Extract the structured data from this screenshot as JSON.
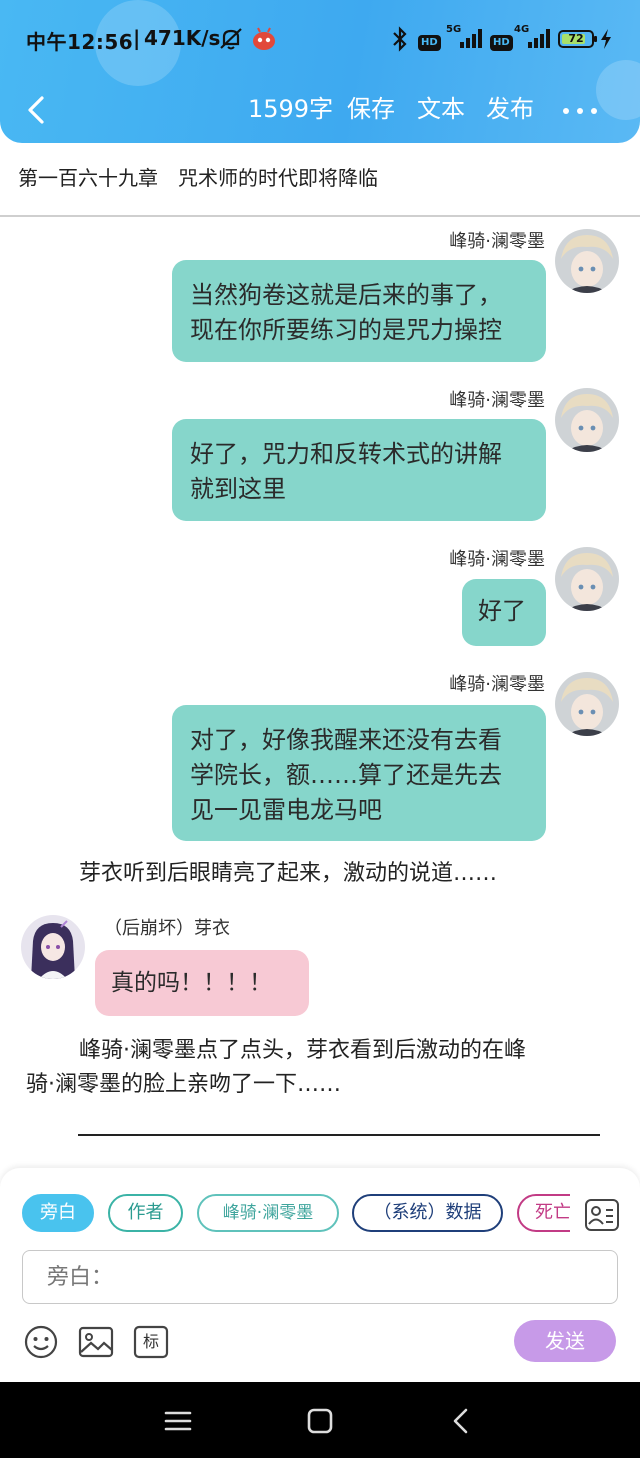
{
  "status_bar": {
    "time": "中午12:56",
    "speed": "471K/s",
    "signal_1": "5G",
    "signal_2": "4G",
    "battery": "72",
    "hd": "HD"
  },
  "header": {
    "word_count": "1599字",
    "save_label": "保存",
    "text_label": "文本",
    "publish_label": "发布"
  },
  "chapter": {
    "title": "第一百六十九章　咒术师的时代即将降临"
  },
  "messages": [
    {
      "name": "峰骑·澜零墨",
      "text_lines": [
        "当然狗卷这就是后来的事了，",
        "现在你所要练习的是咒力操控"
      ]
    },
    {
      "name": "峰骑·澜零墨",
      "text_lines": [
        "好了，咒力和反转术式的讲解",
        "就到这里"
      ]
    },
    {
      "name": "峰骑·澜零墨",
      "text_lines": [
        "好了"
      ]
    },
    {
      "name": "峰骑·澜零墨",
      "text_lines": [
        "对了，好像我醒来还没有去看",
        "学院长，额……算了还是先去",
        "见一见雷电龙马吧"
      ]
    }
  ],
  "narration_1": "芽衣听到后眼睛亮了起来，激动的说道……",
  "left_message": {
    "name": "（后崩坏）芽衣",
    "text": "真的吗！！！！"
  },
  "narration_2_lines": [
    "峰骑·澜零墨点了点头，芽衣看到后激动的在峰",
    "骑·澜零墨的脸上亲吻了一下……"
  ],
  "composer": {
    "roles": [
      "旁白",
      "作者",
      "峰骑·澜零墨",
      "（系统）数据",
      "死亡"
    ],
    "input_placeholder": "旁白：",
    "mark_label": "标",
    "send_label": "发送"
  },
  "colors": {
    "header": "#49b8f3",
    "right_bubble": "#86d6cb",
    "left_bubble": "#f7c9d4",
    "chip_active": "#49c3ee",
    "chip_author": "#3bb3a6",
    "chip_role": "#5fc2bb",
    "chip_system": "#1f3f7a",
    "chip_death": "#c23b85",
    "send": "#c79ae8"
  }
}
